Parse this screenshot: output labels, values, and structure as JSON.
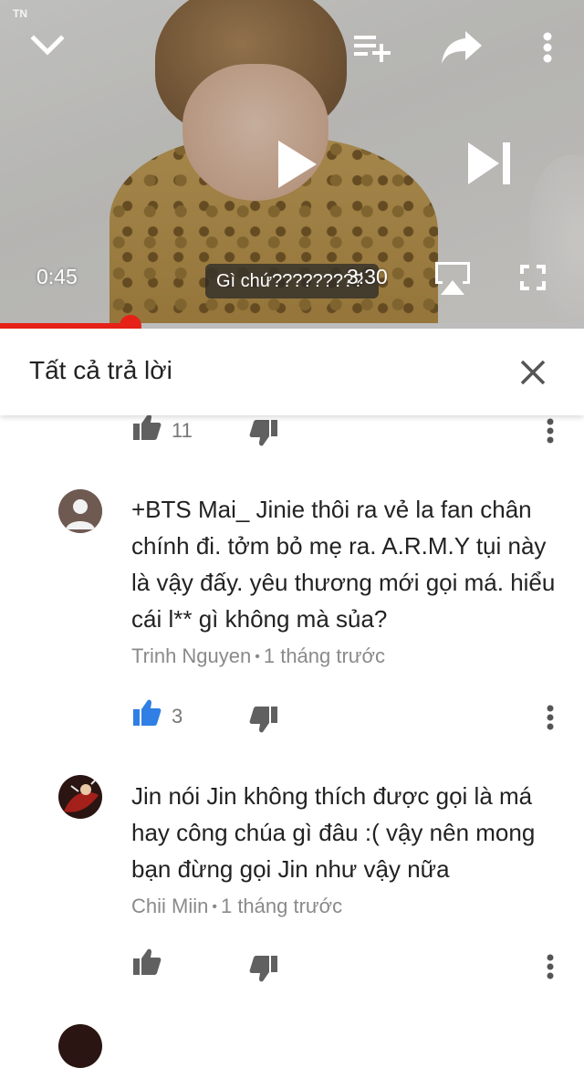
{
  "player": {
    "watermark": "TN",
    "current_time": "0:45",
    "duration": "3:30",
    "caption": "Gì chứ?????????",
    "progress_fraction": 0.224,
    "accent": "#e62117",
    "icons": [
      "chevron-down-icon",
      "add-to-playlist-icon",
      "share-icon",
      "more-vert-icon",
      "play-icon",
      "skip-next-icon",
      "airplay-icon",
      "fullscreen-icon"
    ]
  },
  "replies_panel": {
    "title": "Tất cả trả lời",
    "close_icon": "close-icon"
  },
  "comments": [
    {
      "like_count": "11",
      "liked": false
    },
    {
      "text": "+BTS Mai_ Jinie thôi ra vẻ la fan chân chính đi. tởm bỏ mẹ ra. A.R.M.Y tụi này là vậy đấy. yêu thương mới gọi má. hiểu cái l** gì không mà sủa?",
      "author": "Trinh Nguyen",
      "time": "1 tháng trước",
      "like_count": "3",
      "liked": true
    },
    {
      "text": "Jin nói Jin không thích được gọi là má hay công chúa gì đâu :( vậy nên mong bạn đừng gọi Jin như vậy nữa",
      "author": "Chii Miin",
      "time": "1 tháng trước",
      "like_count": "",
      "liked": false
    }
  ],
  "colors": {
    "like_active": "#2f7fe4",
    "icon_gray": "#6b6b6b"
  }
}
